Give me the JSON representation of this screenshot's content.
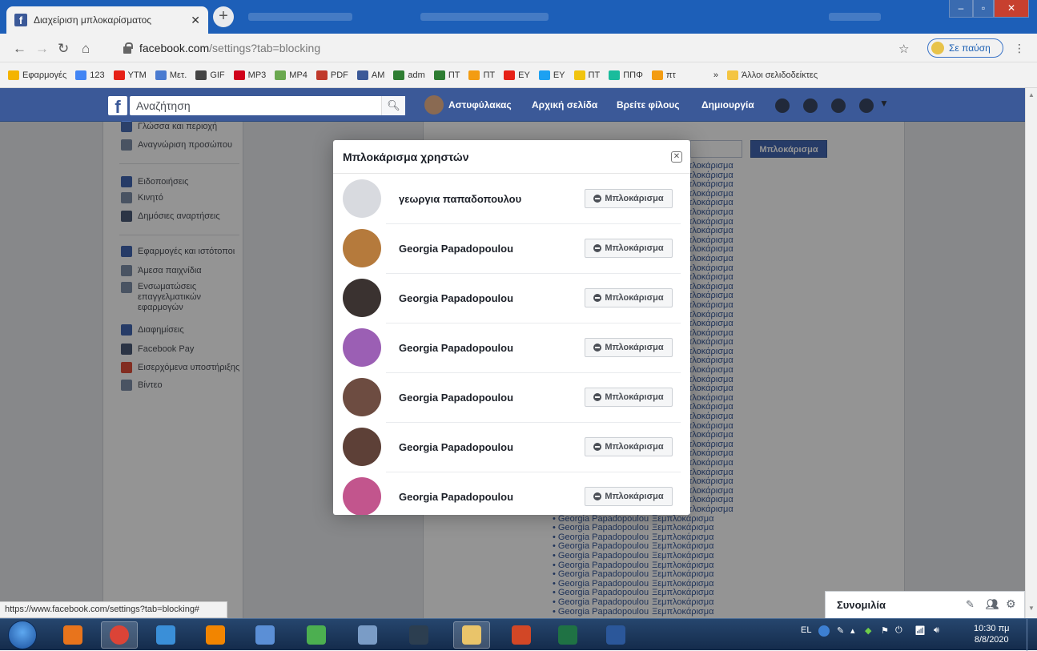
{
  "browser": {
    "tab_title": "Διαχείριση μπλοκαρίσματος",
    "url_host": "facebook.com",
    "url_path": "/settings?tab=blocking",
    "profile_label": "Σε παύση",
    "status_url": "https://www.facebook.com/settings?tab=blocking#"
  },
  "bookmarks": [
    {
      "label": "Εφαρμογές",
      "color": "#f4b400"
    },
    {
      "label": "123",
      "color": "#4285f4"
    },
    {
      "label": "YTM",
      "color": "#e62117"
    },
    {
      "label": "Μετ.",
      "color": "#4a7bd0"
    },
    {
      "label": "GIF",
      "color": "#444444"
    },
    {
      "label": "MP3",
      "color": "#d0021b"
    },
    {
      "label": "MP4",
      "color": "#6aa84f"
    },
    {
      "label": "PDF",
      "color": "#c0392b"
    },
    {
      "label": "ΑΜ",
      "color": "#3b5998"
    },
    {
      "label": "adm",
      "color": "#2e7d32"
    },
    {
      "label": "ΠΤ",
      "color": "#2e7d32"
    },
    {
      "label": "ΠΤ",
      "color": "#f39c12"
    },
    {
      "label": "ΕΥ",
      "color": "#e62117"
    },
    {
      "label": "ΕΥ",
      "color": "#1da1f2"
    },
    {
      "label": "ΠΤ",
      "color": "#f1c40f"
    },
    {
      "label": "ΠΠΦ",
      "color": "#1abc9c"
    },
    {
      "label": "πτ",
      "color": "#f39c12"
    }
  ],
  "bookmarks_more": "»",
  "bookmarks_other": "Άλλοι σελιδοδείκτες",
  "fb": {
    "search_placeholder": "Αναζήτηση",
    "user_name": "Αστυφύλακας",
    "home": "Αρχική σελίδα",
    "find_friends": "Βρείτε φίλους",
    "create": "Δημιουργία"
  },
  "sidebar": {
    "group1": [
      "Γλώσσα και περιοχή",
      "Αναγνώριση προσώπου"
    ],
    "group2": [
      "Ειδοποιήσεις",
      "Κινητό",
      "Δημόσιες αναρτήσεις"
    ],
    "group3": [
      "Εφαρμογές και ιστότοποι",
      "Άμεσα παιχνίδια",
      "Ενσωματώσεις επαγγελματικών εφαρμογών",
      "Διαφημίσεις",
      "Facebook Pay",
      "Εισερχόμενα υποστήριξης",
      "Βίντεο"
    ],
    "icon_colors": [
      "#4b6fb6",
      "#7f8fa9",
      "#4267b2",
      "#7f8fa9",
      "#4b5b78",
      "#4267b2",
      "#7f8fa9",
      "#7f8fa9",
      "#4267b2",
      "#4b5b78",
      "#e04e39",
      "#7f8fa9"
    ]
  },
  "background_block_button": "Μπλοκάρισμα",
  "background_list": {
    "item_name": "Georgia Papadopoulou",
    "item_action": "Ξεμπλοκάρισμα",
    "item_action_short": "τλοκάρισμα"
  },
  "modal": {
    "title": "Μπλοκάρισμα χρηστών",
    "button_label": "Μπλοκάρισμα",
    "rows": [
      {
        "name": "γεωργια παπαδοπουλου",
        "avatar": "#d8dadf"
      },
      {
        "name": "Georgia Papadopoulou",
        "avatar": "#b57a3c"
      },
      {
        "name": "Georgia Papadopoulou",
        "avatar": "#3a3230"
      },
      {
        "name": "Georgia Papadopoulou",
        "avatar": "#9b5fb4"
      },
      {
        "name": "Georgia Papadopoulou",
        "avatar": "#6d4c41"
      },
      {
        "name": "Georgia Papadopoulou",
        "avatar": "#5d4037"
      },
      {
        "name": "Georgia Papadopoulou",
        "avatar": "#c2558d"
      }
    ]
  },
  "chat": {
    "label": "Συνομιλία"
  },
  "taskbar": {
    "language": "EL",
    "time": "10:30 πμ",
    "date": "8/8/2020",
    "apps": [
      {
        "name": "media",
        "color": "#e8741c"
      },
      {
        "name": "chrome",
        "color": "#db4437"
      },
      {
        "name": "internet-explorer",
        "color": "#3a8fd8"
      },
      {
        "name": "vlc",
        "color": "#f28500"
      },
      {
        "name": "globe",
        "color": "#5b8fd6"
      },
      {
        "name": "green-app",
        "color": "#4caf50"
      },
      {
        "name": "calculator",
        "color": "#7a9cc6"
      },
      {
        "name": "pen-app",
        "color": "#2c3e50"
      },
      {
        "name": "explorer",
        "color": "#e9c46a"
      },
      {
        "name": "powerpoint",
        "color": "#d24726"
      },
      {
        "name": "excel",
        "color": "#1f7244"
      },
      {
        "name": "word",
        "color": "#2b579a"
      }
    ]
  }
}
